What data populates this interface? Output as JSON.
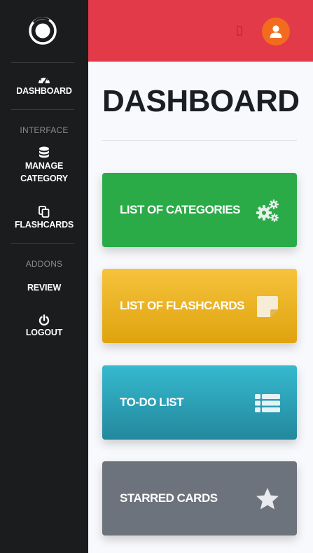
{
  "sidebar": {
    "items": [
      {
        "label": "DASHBOARD",
        "icon": "tachometer-icon"
      },
      {
        "label": "MANAGE CATEGORY",
        "icon": "database-icon"
      },
      {
        "label": "FLASHCARDS",
        "icon": "copy-icon"
      },
      {
        "label": "REVIEW",
        "icon": ""
      },
      {
        "label": "LOGOUT",
        "icon": "power-icon"
      }
    ],
    "headings": [
      "INTERFACE",
      "ADDONS"
    ]
  },
  "topbar": {
    "color": "#e23a48",
    "avatar_color": "#f26b1f"
  },
  "main": {
    "title": "DASHBOARD",
    "cards": [
      {
        "label": "LIST OF CATEGORIES",
        "icon": "cogs-icon",
        "color": "#2aab48"
      },
      {
        "label": "LIST OF FLASHCARDS",
        "icon": "sticky-note-icon",
        "color": "#f0b424"
      },
      {
        "label": "TO-DO LIST",
        "icon": "list-icon",
        "color": "#2ca3b8"
      },
      {
        "label": "STARRED CARDS",
        "icon": "star-icon",
        "color": "#6c737c"
      }
    ]
  }
}
